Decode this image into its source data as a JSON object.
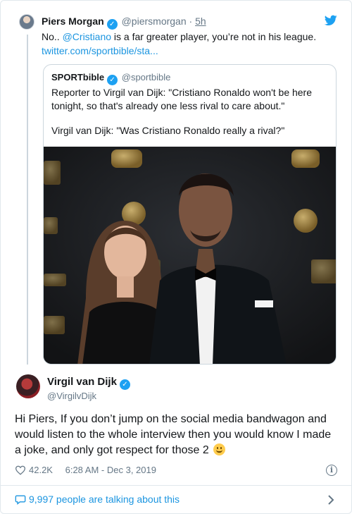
{
  "reply_context": {
    "name": "Piers Morgan",
    "handle": "@piersmorgan",
    "separator": "·",
    "time": "5h",
    "text_before": "No.. ",
    "mention": "@Cristiano",
    "text_after": " is a far greater player, you’re not in his league.",
    "link": "twitter.com/sportbible/sta..."
  },
  "quoted_tweet": {
    "name": "SPORTbible",
    "handle": "@sportbible",
    "paragraph1": "Reporter to Virgil van Dijk: \"Cristiano Ronaldo won't be here tonight, so that's already one less rival to care about.\"",
    "paragraph2": "Virgil van Dijk: \"Was Cristiano Ronaldo really a rival?\""
  },
  "tweet": {
    "name": "Virgil van Dijk",
    "handle": "@VirgilvDijk",
    "text": "Hi Piers, If you don’t jump on the social media bandwagon and would listen to the whole interview then you would know I made a joke, and only got respect for those 2",
    "likes": "42.2K",
    "timestamp": "6:28 AM - Dec 3, 2019"
  },
  "footer": {
    "talking": "9,997 people are talking about this"
  },
  "colors": {
    "link_blue": "#1b95e0",
    "twitter_blue": "#1da1f2",
    "muted": "#657786",
    "border": "#e1e8ed"
  },
  "icons": [
    "verified-badge-icon",
    "twitter-bird-icon",
    "heart-icon",
    "info-icon",
    "speech-bubble-icon",
    "chevron-right-icon",
    "smiling-face-emoji-icon"
  ]
}
